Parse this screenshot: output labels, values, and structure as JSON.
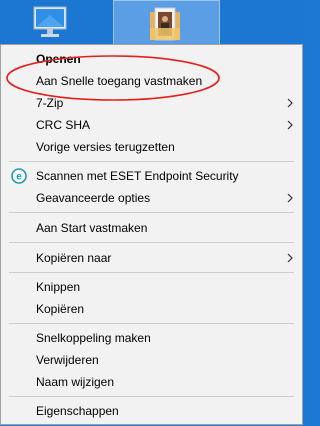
{
  "colors": {
    "desktop": "#1c77d2",
    "menu_bg": "#f2f2f2",
    "annotation": "#e5201c",
    "eset": "#1a9bb5"
  },
  "desktop": {
    "icons": [
      "pc-icon",
      "folder-icon"
    ]
  },
  "menu": {
    "items": [
      {
        "label": "Openen",
        "bold": true
      },
      {
        "label": "Aan Snelle toegang vastmaken"
      },
      {
        "label": "7-Zip",
        "submenu": true
      },
      {
        "label": "CRC SHA",
        "submenu": true
      },
      {
        "label": "Vorige versies terugzetten"
      },
      {
        "label": "Scannen met ESET Endpoint Security",
        "icon": "eset-icon"
      },
      {
        "label": "Geavanceerde opties",
        "submenu": true
      },
      {
        "label": "Aan Start vastmaken"
      },
      {
        "label": "Kopiëren naar",
        "submenu": true
      },
      {
        "label": "Knippen"
      },
      {
        "label": "Kopiëren"
      },
      {
        "label": "Snelkoppeling maken"
      },
      {
        "label": "Verwijderen"
      },
      {
        "label": "Naam wijzigen"
      },
      {
        "label": "Eigenschappen"
      }
    ]
  }
}
